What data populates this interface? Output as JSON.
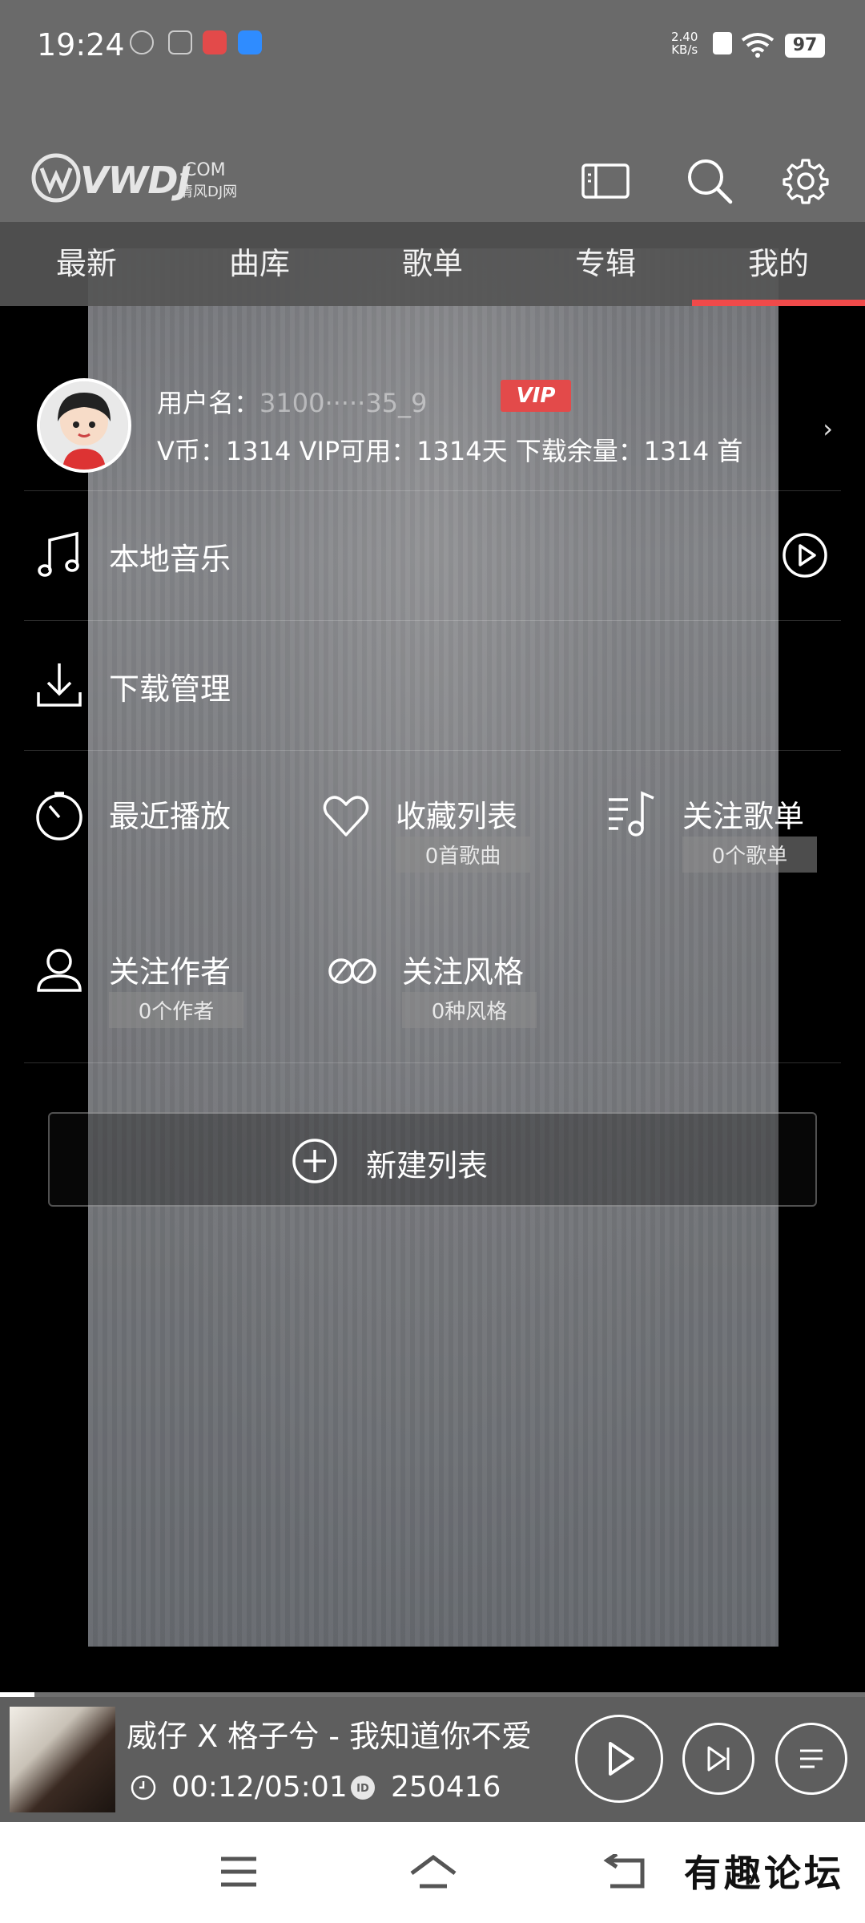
{
  "status_bar": {
    "time": "19:24",
    "net_speed_value": "2.40",
    "net_speed_unit": "KB/s",
    "battery": "97"
  },
  "header": {
    "logo_text": "VWDJ",
    "logo_com": ".COM",
    "logo_sub": "清风DJ网",
    "icons": [
      "windows-icon",
      "search-icon",
      "gear-icon"
    ]
  },
  "tabs": [
    {
      "label": "最新",
      "active": false
    },
    {
      "label": "曲库",
      "active": false
    },
    {
      "label": "歌单",
      "active": false
    },
    {
      "label": "专辑",
      "active": false
    },
    {
      "label": "我的",
      "active": true
    }
  ],
  "profile": {
    "username_label": "用户名：",
    "username_value": "3100·····35_9",
    "vip_badge": "VIP",
    "stats": "V币：1314   VIP可用：1314天  下载余量：1314 首"
  },
  "menu": {
    "local_music": "本地音乐",
    "download_manage": "下载管理",
    "recent_play": "最近播放",
    "favorites": {
      "label": "收藏列表",
      "sub": "0首歌曲"
    },
    "followed_playlists": {
      "label": "关注歌单",
      "sub": "0个歌单"
    },
    "followed_authors": {
      "label": "关注作者",
      "sub": "0个作者"
    },
    "followed_styles": {
      "label": "关注风格",
      "sub": "0种风格"
    },
    "new_list": "新建列表"
  },
  "player": {
    "title": "威仔 X 格子兮 - 我知道你不爱",
    "time": "00:12/05:01",
    "id": "250416",
    "progress": 0.04
  },
  "watermark": "有趣论坛",
  "colors": {
    "accent": "#f04a4a",
    "vip": "#e34a4a",
    "header_bg": "#6a6a6a",
    "player_bg": "#5e5e5e"
  }
}
